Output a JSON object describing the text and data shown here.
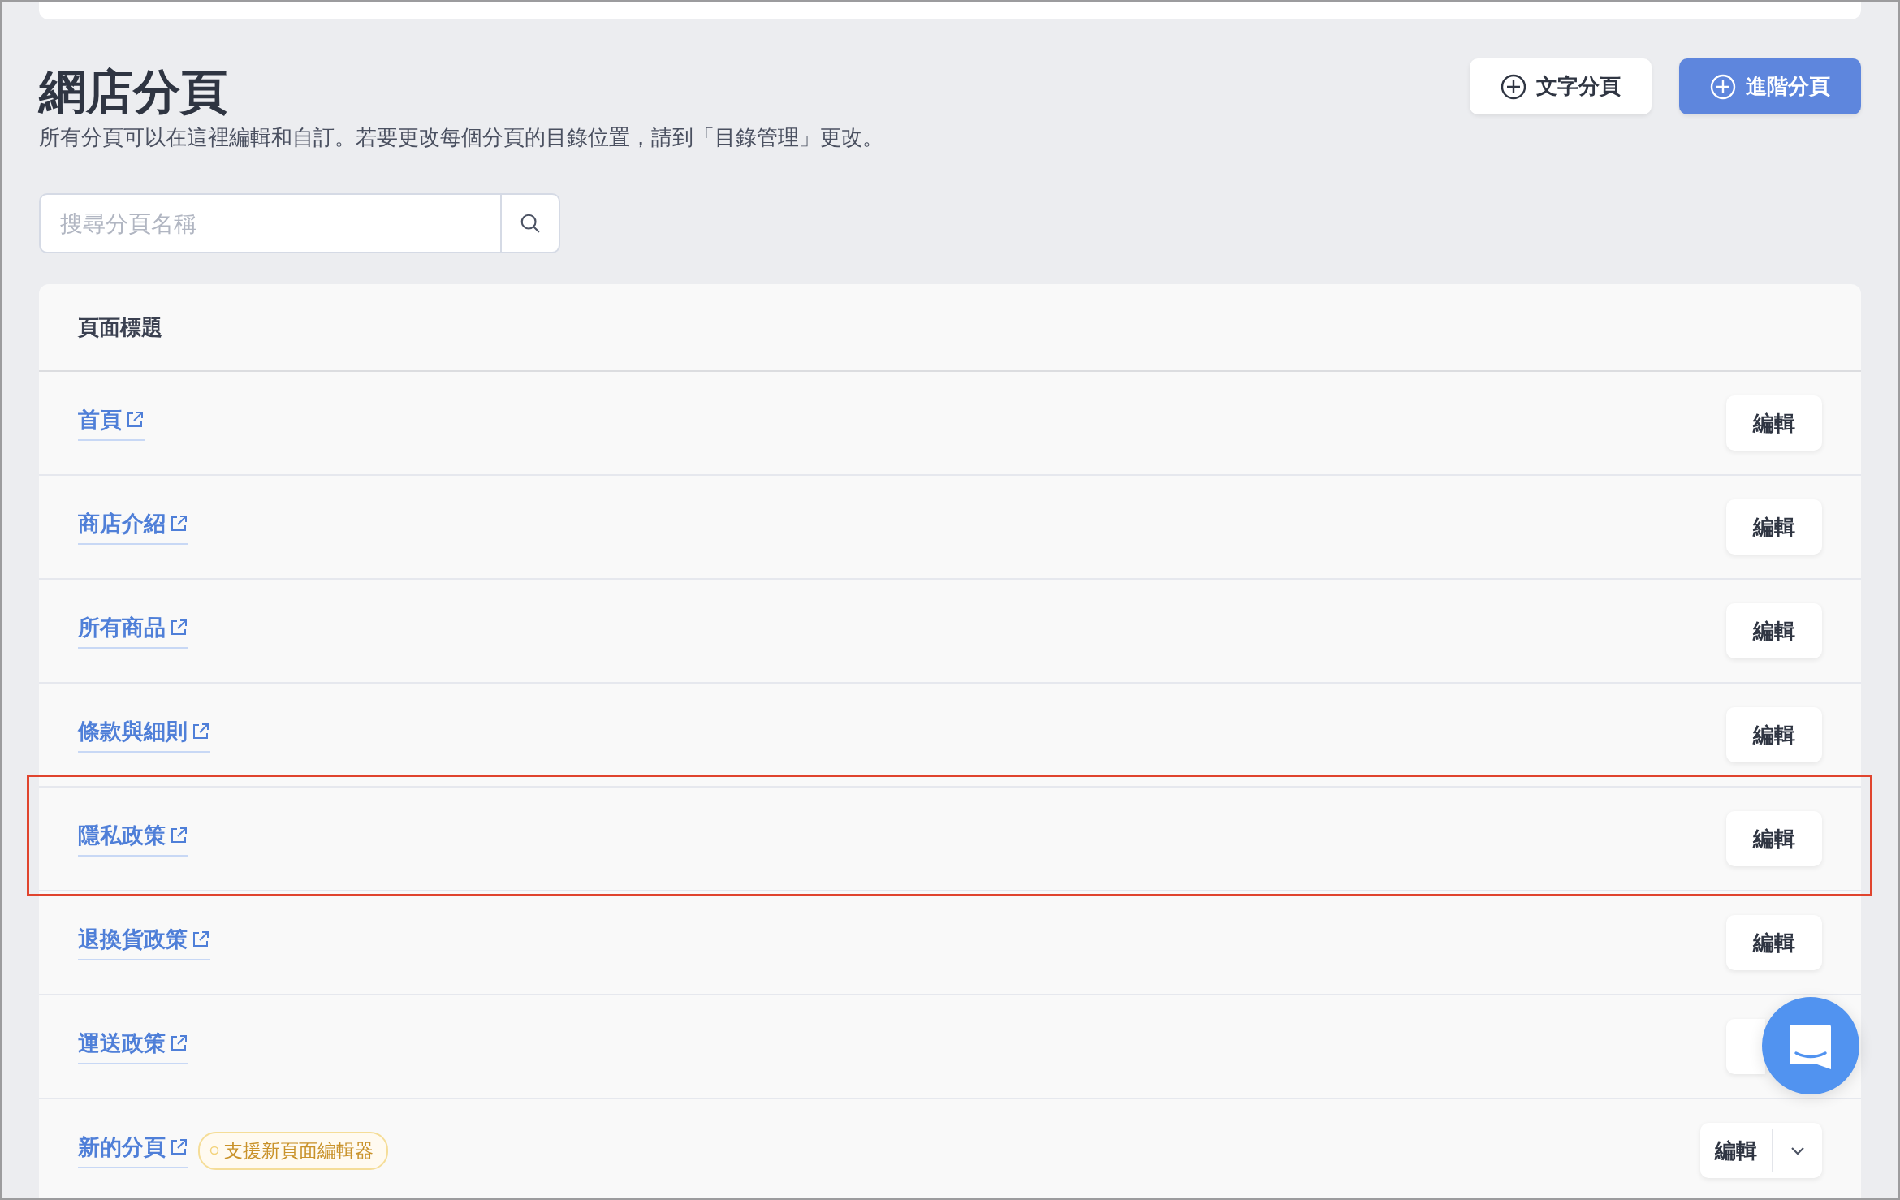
{
  "page": {
    "title": "網店分頁",
    "description": "所有分頁可以在這裡編輯和自訂。若要更改每個分頁的目錄位置，請到「目錄管理」更改。",
    "buttons": [
      {
        "label": "文字分頁",
        "kind": "secondary"
      },
      {
        "label": "進階分頁",
        "kind": "primary"
      }
    ]
  },
  "search": {
    "placeholder": "搜尋分頁名稱"
  },
  "table": {
    "columns": [
      "頁面標題"
    ],
    "rows": [
      {
        "title": "首頁",
        "edit": "編輯",
        "highlighted": false
      },
      {
        "title": "商店介紹",
        "edit": "編輯",
        "highlighted": false
      },
      {
        "title": "所有商品",
        "edit": "編輯",
        "highlighted": false
      },
      {
        "title": "條款與細則",
        "edit": "編輯",
        "highlighted": false
      },
      {
        "title": "隱私政策",
        "edit": "編輯",
        "highlighted": true
      },
      {
        "title": "退換貨政策",
        "edit": "編輯",
        "highlighted": false
      },
      {
        "title": "運送政策",
        "highlighted": false
      },
      {
        "title": "新的分頁",
        "badge": "支援新頁面編輯器",
        "edit": "編輯",
        "highlighted": false,
        "has_menu": true
      }
    ]
  }
}
